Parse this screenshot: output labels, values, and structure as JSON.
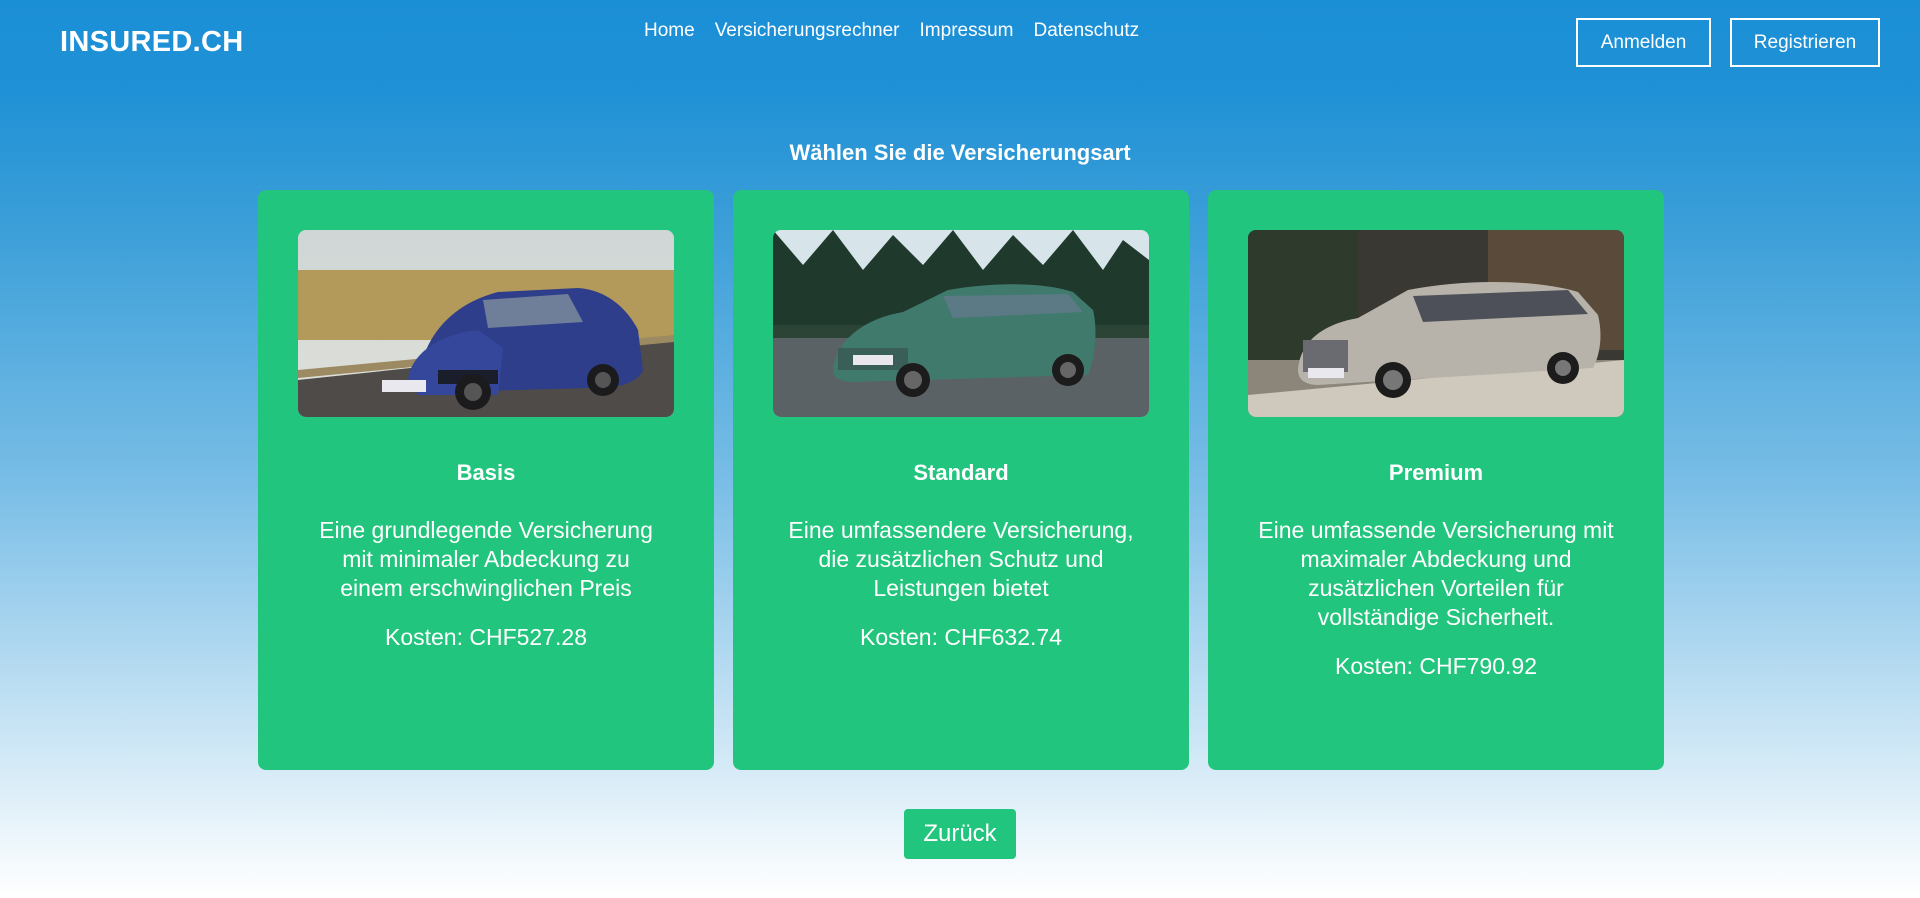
{
  "header": {
    "logo": "INSURED.CH",
    "nav": [
      "Home",
      "Versicherungsrechner",
      "Impressum",
      "Datenschutz"
    ],
    "login_label": "Anmelden",
    "register_label": "Registrieren"
  },
  "main": {
    "title": "Wählen Sie die Versicherungsart",
    "cards": [
      {
        "title": "Basis",
        "description": "Eine grundlegende Versicherung mit minimaler Abdeckung zu einem erschwinglichen Preis",
        "price": "Kosten: CHF527.28",
        "image": "blue-hatchback-car-photo"
      },
      {
        "title": "Standard",
        "description": "Eine umfassendere Versicherung, die zusätzlichen Schutz und Leistungen bietet",
        "price": "Kosten: CHF632.74",
        "image": "green-station-wagon-car-photo"
      },
      {
        "title": "Premium",
        "description": "Eine umfassende Versicherung mit maximaler Abdeckung und zusätzlichen Vorteilen für vollständige Sicherheit.",
        "price": "Kosten: CHF790.92",
        "image": "silver-luxury-sedan-car-photo"
      }
    ],
    "back_label": "Zurück"
  },
  "colors": {
    "header_blue": "#1b8fd6",
    "card_green": "#22c57d",
    "text": "#ffffff"
  }
}
